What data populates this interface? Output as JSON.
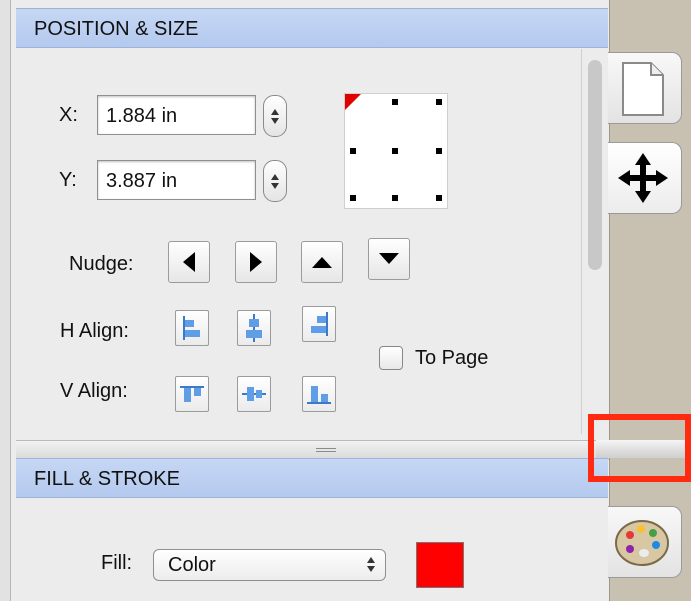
{
  "position_size": {
    "title": "POSITION & SIZE",
    "x_label": "X:",
    "x_value": "1.884 in",
    "y_label": "Y:",
    "y_value": "3.887 in",
    "nudge_label": "Nudge:",
    "h_align_label": "H Align:",
    "v_align_label": "V Align:",
    "to_page_label": "To Page",
    "to_page_checked": false
  },
  "fill_stroke": {
    "title": "FILL & STROKE",
    "fill_label": "Fill:",
    "fill_type": "Color",
    "fill_color": "#ff0000"
  },
  "icons": [
    "page-icon",
    "move-arrows-icon",
    "palette-icon"
  ],
  "colors": {
    "header_blue": "#bfd2f2",
    "highlight": "#ff2a10"
  }
}
